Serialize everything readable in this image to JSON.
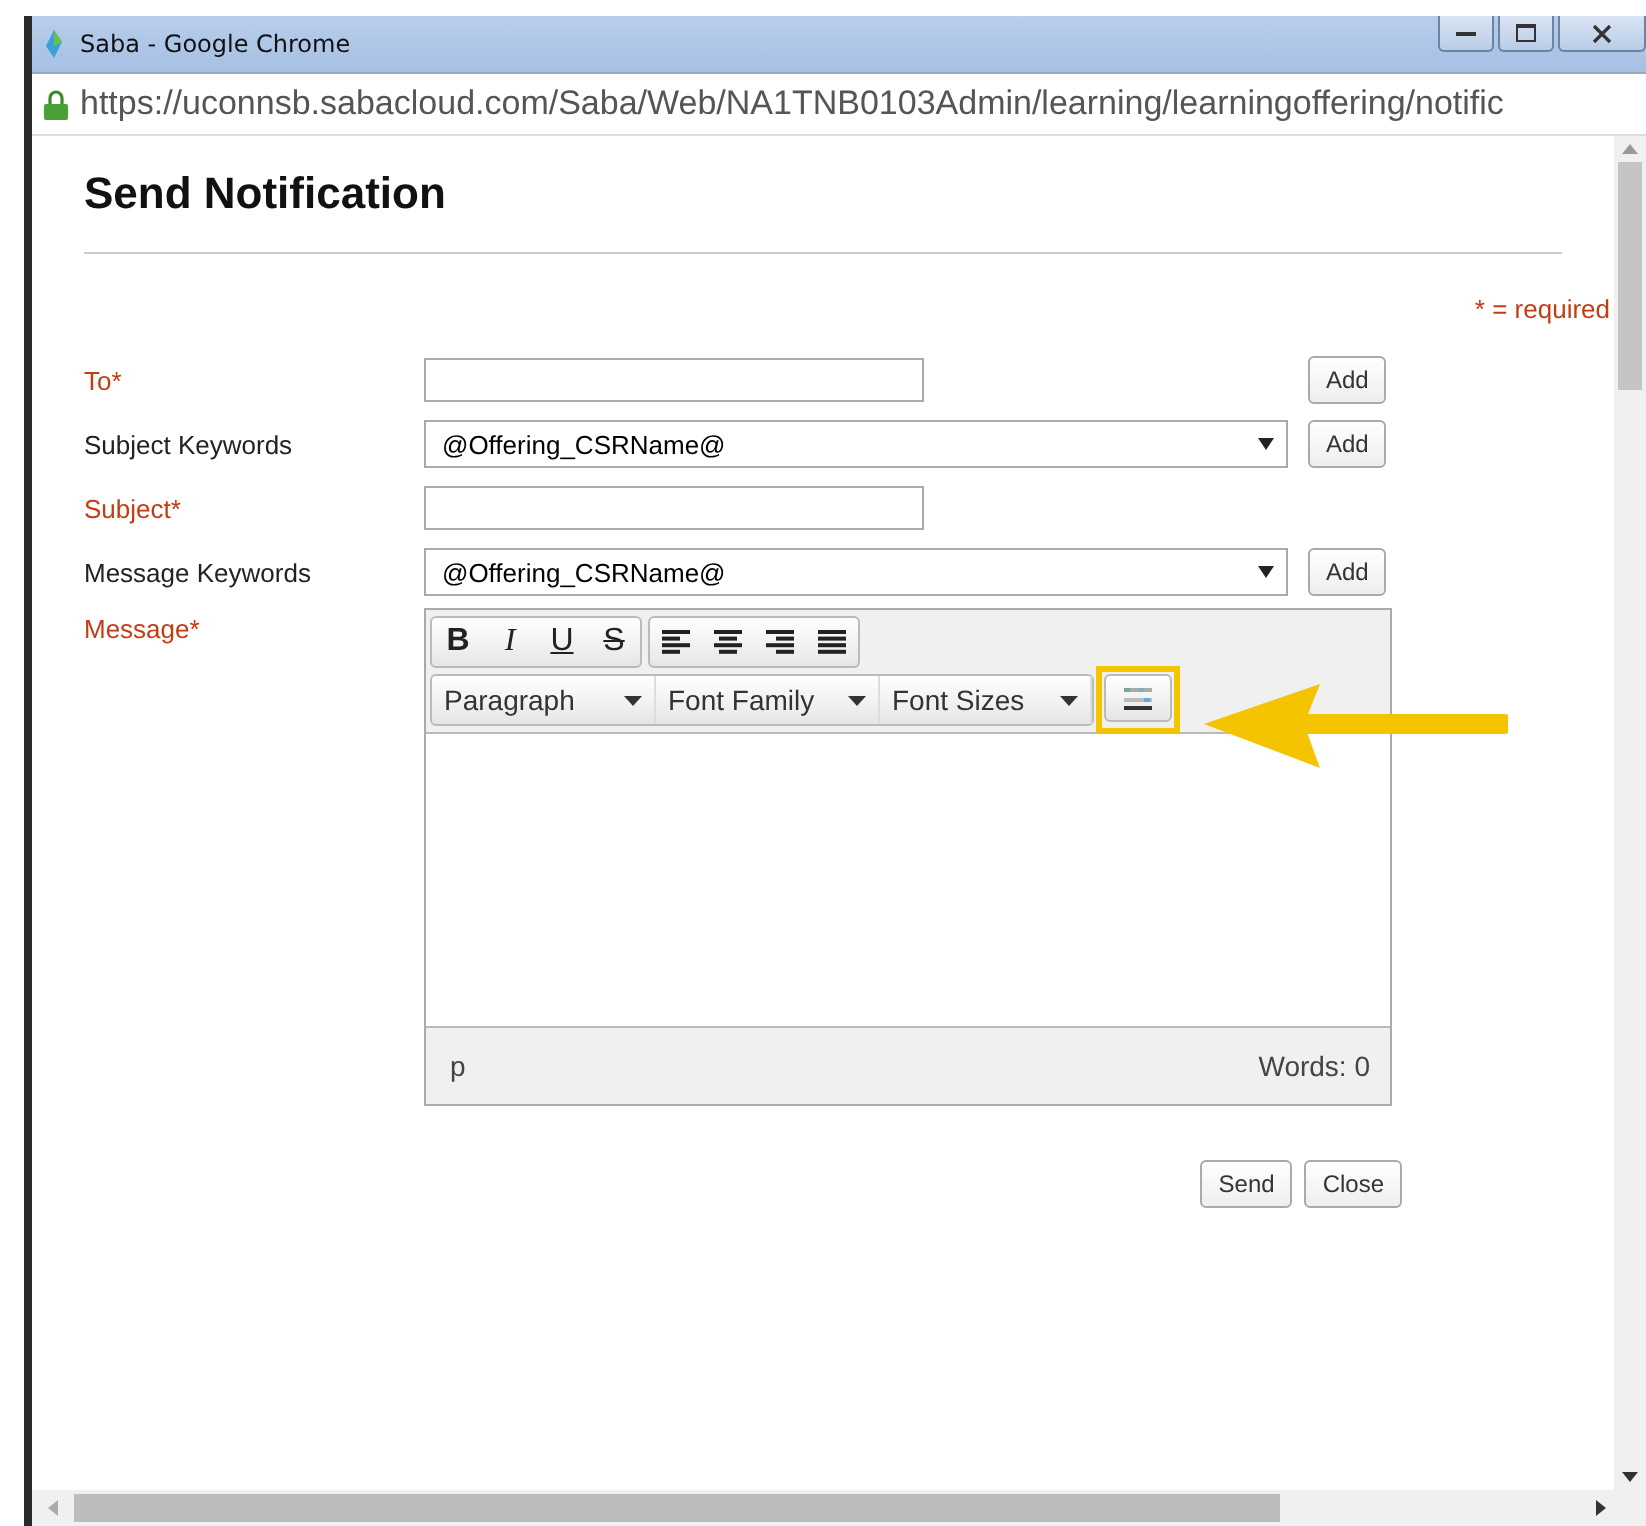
{
  "window": {
    "title": "Saba - Google Chrome"
  },
  "address_bar": {
    "url": "https://uconnsb.sabacloud.com/Saba/Web/NA1TNB0103Admin/learning/learningoffering/notific"
  },
  "page": {
    "heading": "Send Notification",
    "required_note": "* = required"
  },
  "fields": [
    {
      "kind": "text",
      "label": "To*",
      "required": true,
      "button": "Add"
    },
    {
      "kind": "select",
      "label": "Subject Keywords",
      "required": false,
      "value": "@Offering_CSRName@",
      "button": "Add"
    },
    {
      "kind": "text",
      "label": "Subject*",
      "required": true
    },
    {
      "kind": "select",
      "label": "Message Keywords",
      "required": false,
      "value": "@Offering_CSRName@",
      "button": "Add"
    },
    {
      "kind": "editor",
      "label": "Message*",
      "required": true
    }
  ],
  "editor": {
    "format_buttons": [
      "B",
      "I",
      "U",
      "S"
    ],
    "align_buttons": [
      {
        "kind": "left"
      },
      {
        "kind": "center"
      },
      {
        "kind": "right"
      },
      {
        "kind": "justify"
      }
    ],
    "dropdowns": [
      "Paragraph",
      "Font Family",
      "Font Sizes"
    ],
    "highlighted_button": true,
    "path": "p",
    "word_count": "Words: 0"
  },
  "buttons": [
    "Send",
    "Close"
  ]
}
